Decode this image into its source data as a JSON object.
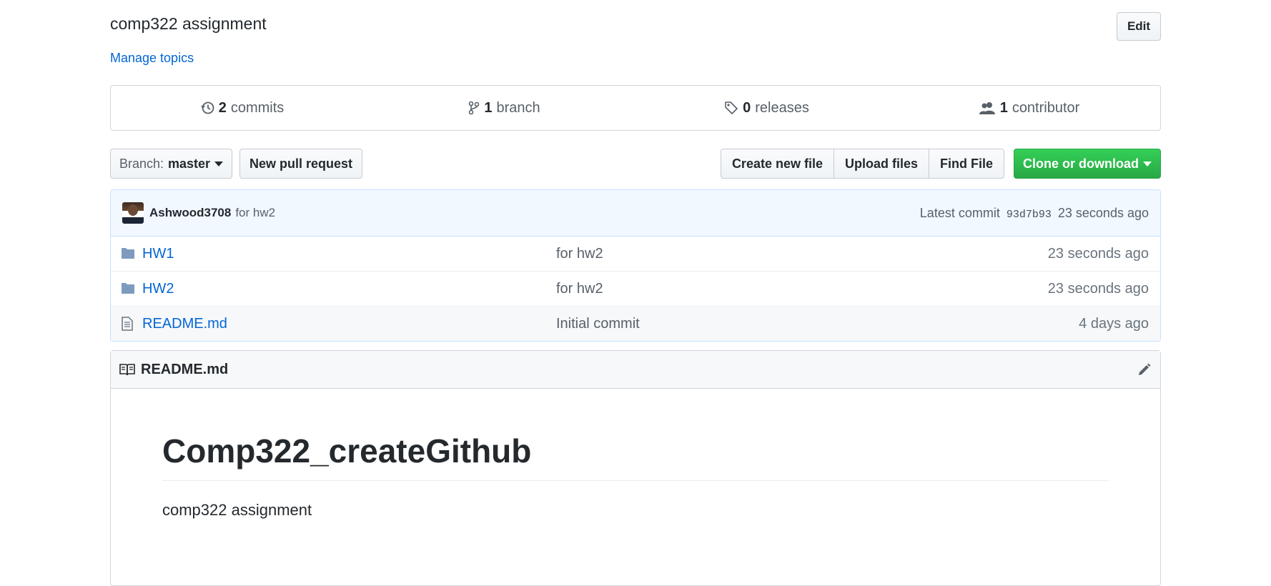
{
  "repo": {
    "description": "comp322 assignment",
    "manage_topics": "Manage topics",
    "edit_label": "Edit"
  },
  "summary": {
    "commits": {
      "count": "2",
      "label": "commits"
    },
    "branches": {
      "count": "1",
      "label": "branch"
    },
    "releases": {
      "count": "0",
      "label": "releases"
    },
    "contributors": {
      "count": "1",
      "label": "contributor"
    }
  },
  "toolbar": {
    "branch_label": "Branch:",
    "branch_value": "master",
    "new_pr": "New pull request",
    "create_file": "Create new file",
    "upload_files": "Upload files",
    "find_file": "Find File",
    "clone": "Clone or download"
  },
  "commit": {
    "author": "Ashwood3708",
    "message": "for hw2",
    "latest_label": "Latest commit",
    "sha": "93d7b93",
    "age": "23 seconds ago"
  },
  "files": [
    {
      "name": "HW1",
      "type": "folder",
      "message": "for hw2",
      "age": "23 seconds ago"
    },
    {
      "name": "HW2",
      "type": "folder",
      "message": "for hw2",
      "age": "23 seconds ago"
    },
    {
      "name": "README.md",
      "type": "file",
      "message": "Initial commit",
      "age": "4 days ago"
    }
  ],
  "readme": {
    "filename": "README.md",
    "heading": "Comp322_createGithub",
    "body": "comp322 assignment"
  },
  "colors": {
    "link": "#0366d6",
    "clone_green": "#28a745",
    "commit_bg": "#f1f8ff"
  }
}
